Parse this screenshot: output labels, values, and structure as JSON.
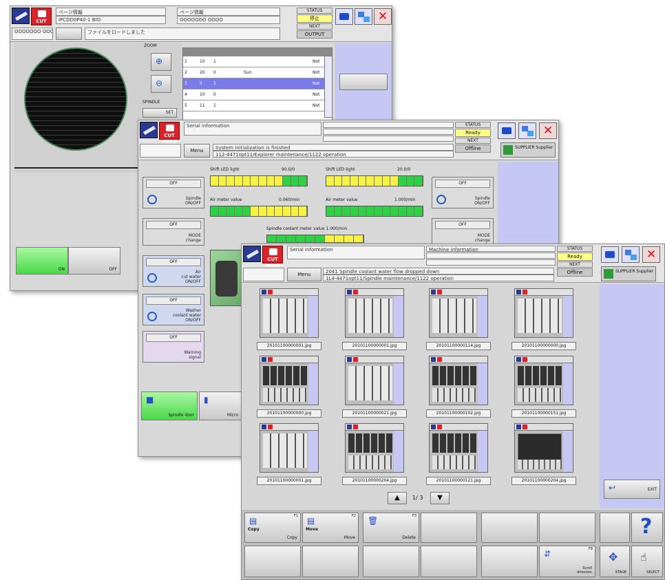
{
  "win1": {
    "info_top": "ページ情報",
    "info_line2": "IPCDD0P40-1 BIO",
    "ogo": "OOOOOOO OOOO",
    "status_label": "STATUS",
    "status_value": "停止",
    "next_label": "NEXT",
    "alarm_btn": "OUTPUT",
    "message": "ファイルをロードしました",
    "zoom_label": "ZOOM",
    "table_headers": [
      "",
      "",
      "",
      "",
      "",
      "",
      ""
    ],
    "table_rows": [
      {
        "c1": "1",
        "c2": "10",
        "c3": "1",
        "c4": "",
        "c5": "Not"
      },
      {
        "c1": "2",
        "c2": "20",
        "c3": "0",
        "c4": "Sun",
        "c5": "Not"
      },
      {
        "c1": "3",
        "c2": "5",
        "c3": "1",
        "c4": "",
        "c5": "Not"
      },
      {
        "c1": "4",
        "c2": "10",
        "c3": "0",
        "c4": "",
        "c5": "Not"
      },
      {
        "c1": "5",
        "c2": "11",
        "c3": "1",
        "c4": "",
        "c5": "Not"
      }
    ],
    "side_label": "SPINDLE",
    "set_btn": "SET",
    "btn_a": "ON",
    "btn_b": "OFF"
  },
  "win2": {
    "info_label": "Serial information",
    "status_label": "STATUS",
    "status_value": "Ready",
    "next_label": "NEXT",
    "offline": "Offline",
    "supplier": "SUPPLIER Supplier",
    "menu": "Menu",
    "msg1": "System initialization is finished",
    "msg2": "112-4471opt11/Explorer maintenance/1122 operation",
    "gauge1_label": "Shift LED light",
    "gauge1_val": "90.0/0",
    "gauge2_label": "Shift LED light",
    "gauge2_val": "20.0/0",
    "gauge3_label": "Air meter value",
    "gauge3_val": "0.060/min",
    "gauge4_label": "Air meter value",
    "gauge4_val": "1.000/min",
    "gauge5_label": "Spindle coolant meter value",
    "gauge5_val": "1.000/min",
    "off": "OFF",
    "ctl1": "Spindle\nON/OFF",
    "ctl2": "Spindle\nON/OFF",
    "ctl3": "MODE\nchange",
    "ctl4": "MODE\nchange",
    "ctl5": "Air\ncut water\nON/OFF",
    "ctl6": "Washer\ncoolant water\nON/OFF",
    "ctl7": "Warning\nsignal",
    "btn_spindle": "Spindle door",
    "btn_micro": "Micro"
  },
  "win3": {
    "info_label": "Serial information",
    "sys_label": "Machine information",
    "status_label": "STATUS",
    "status_value": "Ready",
    "next_label": "NEXT",
    "offline": "Offline",
    "supplier": "SUPPLIER Supplier",
    "menu": "Menu",
    "msg1": "2041 Spindle coolant water flow dropped down",
    "msg2": "1L4-4471opt11/Spindle maintenance/1122 operation",
    "thumbs": [
      "20101100000001.jpg",
      "20101100000001.jpg",
      "20101100000114.jpg",
      "20101100000000.jpg",
      "20101100000000.jpg",
      "20101100000021.jpg",
      "20101100000102.jpg",
      "20101100000151.jpg",
      "20101100000001.jpg",
      "20101100000204.jpg",
      "20101100000121.jpg",
      "20101100000204.jpg"
    ],
    "page": "1/ 3",
    "exit": "EXIT",
    "copy_icon": "Copy",
    "copy_label": "Copy",
    "move_icon": "Move",
    "move_label": "Move",
    "delete_label": "Delete",
    "f_copy": "F1",
    "f_move": "F2",
    "f_delete": "F3",
    "f_s": "F8",
    "scroll_label": "Scroll\ndirection",
    "pan_label": "STAGE",
    "select_label": "SELECT",
    "help": "?"
  }
}
